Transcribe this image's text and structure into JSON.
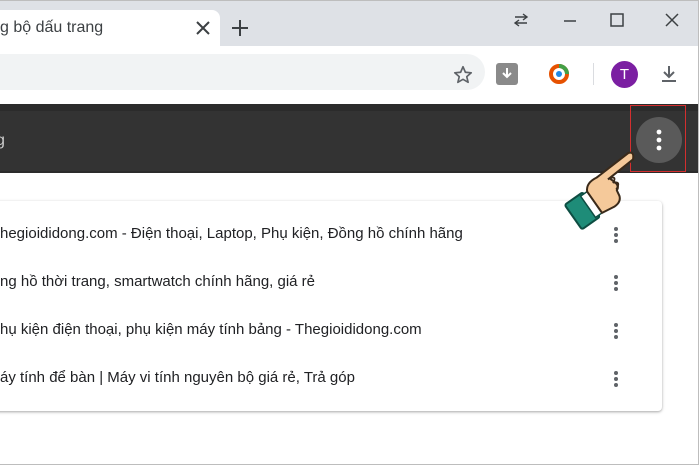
{
  "tab": {
    "title": "g bộ dấu trang",
    "close_icon": "close-icon",
    "new_tab_icon": "plus-icon"
  },
  "window_controls": [
    "back-swap-icon",
    "minimize-icon",
    "maximize-icon",
    "close-icon"
  ],
  "toolbar": {
    "star_icon": "star-icon",
    "extension_download_icon": "download-arrow-icon",
    "extension_ring_icon": "ring-icon",
    "profile_initial": "T",
    "profile_color": "#7b1fa2",
    "download_icon": "download-icon"
  },
  "bookmark_header": {
    "search_fragment": "g",
    "menu_icon": "more-vert-icon",
    "background": "#333333"
  },
  "bookmarks": [
    {
      "title": "hegioididong.com - Điện thoại, Laptop, Phụ kiện, Đồng hồ chính hãng"
    },
    {
      "title": "ng hồ thời trang, smartwatch chính hãng, giá rẻ"
    },
    {
      "title": "hụ kiện điện thoại, phụ kiện máy tính bảng - Thegioididong.com"
    },
    {
      "title": "áy tính để bàn | Máy vi tính nguyên bộ giá rẻ, Trả góp"
    }
  ],
  "annotation": {
    "pointer_icon": "pointing-hand-icon",
    "highlight_color": "#d32f2f"
  }
}
